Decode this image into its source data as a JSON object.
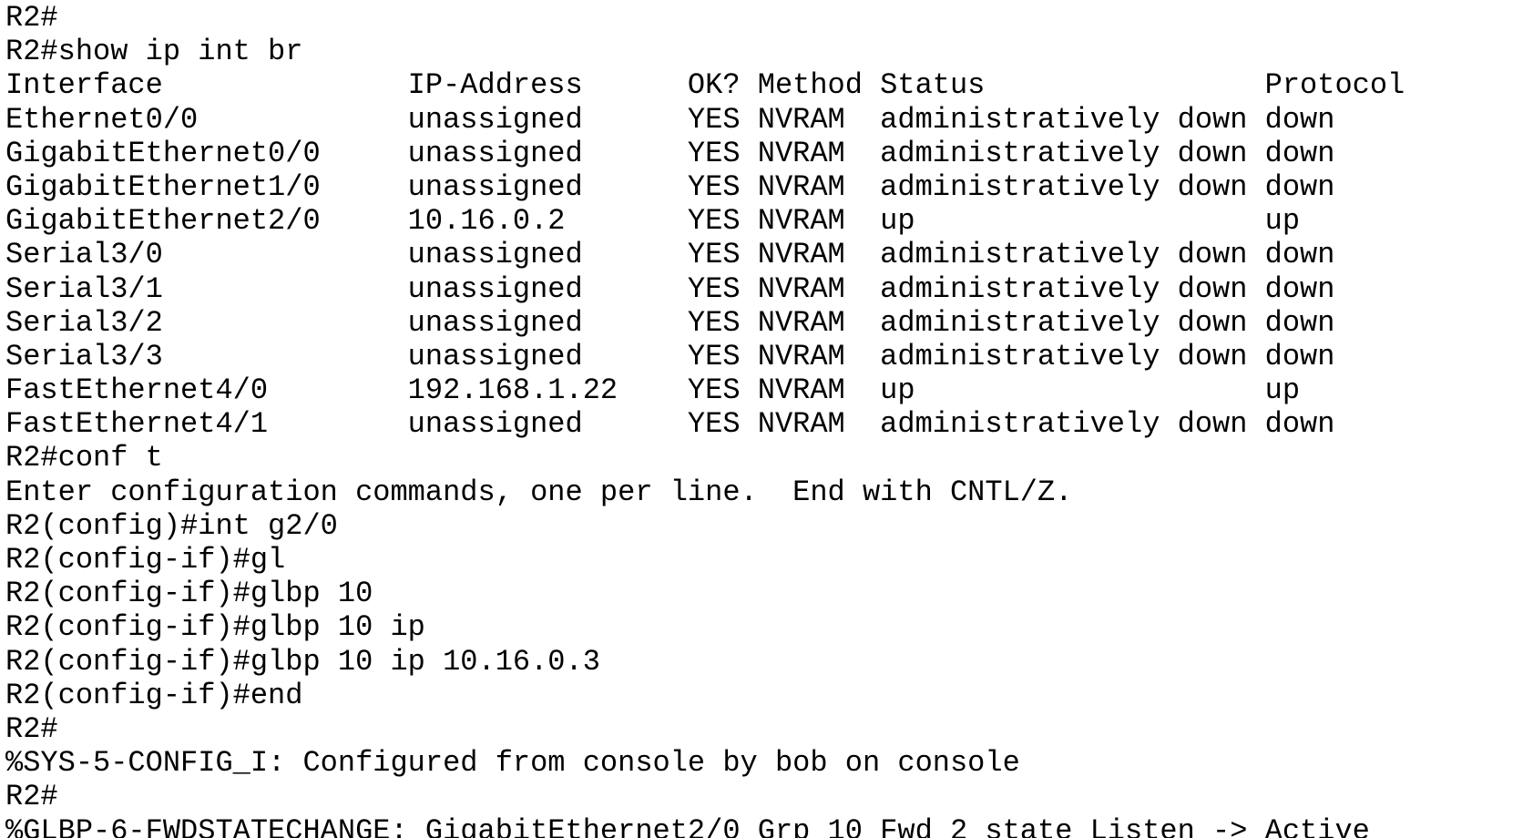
{
  "terminal": {
    "lines": [
      "R2#",
      "R2#show ip int br",
      "Interface              IP-Address      OK? Method Status                Protocol",
      "Ethernet0/0            unassigned      YES NVRAM  administratively down down",
      "GigabitEthernet0/0     unassigned      YES NVRAM  administratively down down",
      "GigabitEthernet1/0     unassigned      YES NVRAM  administratively down down",
      "GigabitEthernet2/0     10.16.0.2       YES NVRAM  up                    up",
      "Serial3/0              unassigned      YES NVRAM  administratively down down",
      "Serial3/1              unassigned      YES NVRAM  administratively down down",
      "Serial3/2              unassigned      YES NVRAM  administratively down down",
      "Serial3/3              unassigned      YES NVRAM  administratively down down",
      "FastEthernet4/0        192.168.1.22    YES NVRAM  up                    up",
      "FastEthernet4/1        unassigned      YES NVRAM  administratively down down",
      "R2#conf t",
      "Enter configuration commands, one per line.  End with CNTL/Z.",
      "R2(config)#int g2/0",
      "R2(config-if)#gl",
      "R2(config-if)#glbp 10",
      "R2(config-if)#glbp 10 ip",
      "R2(config-if)#glbp 10 ip 10.16.0.3",
      "R2(config-if)#end",
      "R2#",
      "%SYS-5-CONFIG_I: Configured from console by bob on console",
      "R2#",
      "%GLBP-6-FWDSTATECHANGE: GigabitEthernet2/0 Grp 10 Fwd 2 state Listen -> Active"
    ]
  }
}
